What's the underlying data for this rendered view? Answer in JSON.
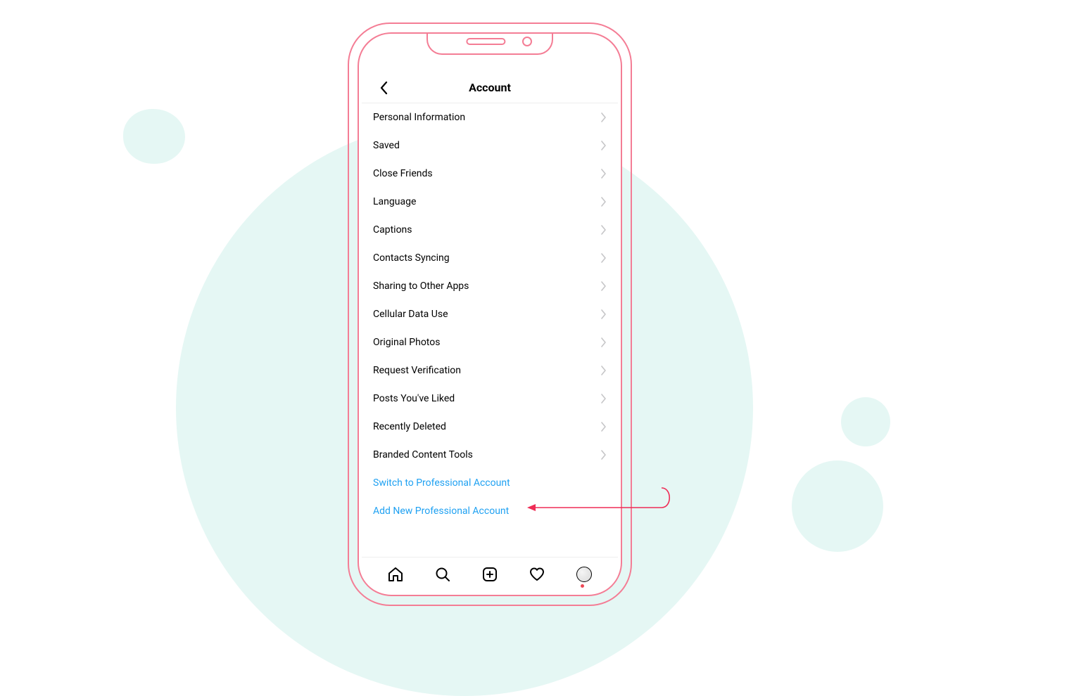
{
  "header": {
    "title": "Account"
  },
  "menu": [
    {
      "label": "Personal Information"
    },
    {
      "label": "Saved"
    },
    {
      "label": "Close Friends"
    },
    {
      "label": "Language"
    },
    {
      "label": "Captions"
    },
    {
      "label": "Contacts Syncing"
    },
    {
      "label": "Sharing to Other Apps"
    },
    {
      "label": "Cellular Data Use"
    },
    {
      "label": "Original Photos"
    },
    {
      "label": "Request Verification"
    },
    {
      "label": "Posts You've Liked"
    },
    {
      "label": "Recently Deleted"
    },
    {
      "label": "Branded Content Tools"
    }
  ],
  "links": {
    "switch_pro": "Switch to Professional Account",
    "add_pro": "Add New Professional Account"
  },
  "colors": {
    "sketch": "#f47d95",
    "link_blue": "#1fa1f2",
    "bg_circle": "#e5f7f4"
  }
}
